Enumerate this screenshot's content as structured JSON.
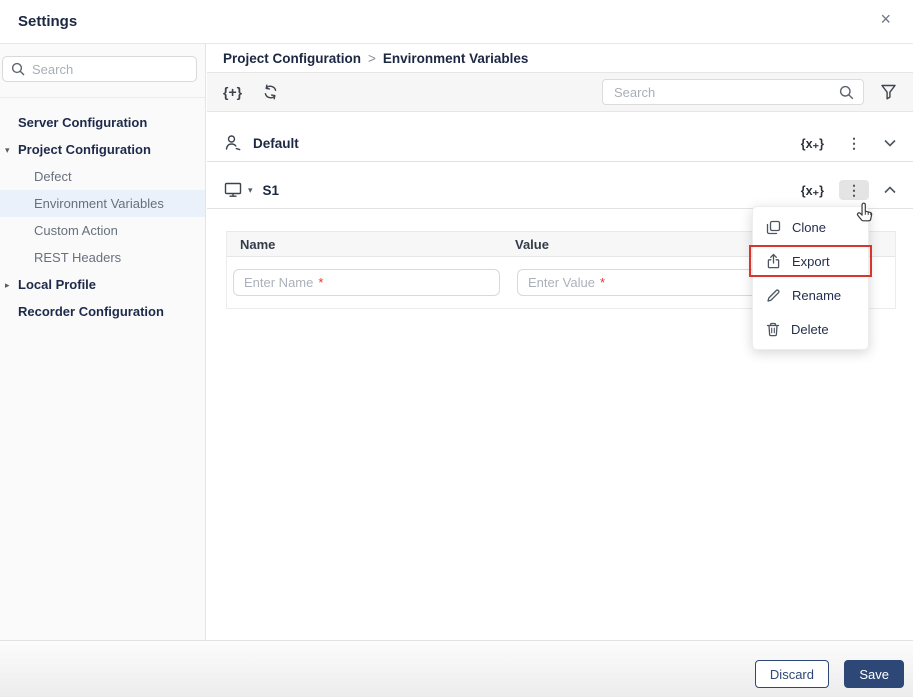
{
  "window": {
    "title": "Settings",
    "close_icon": "×"
  },
  "sidebar": {
    "search": {
      "placeholder": "Search"
    },
    "items": [
      {
        "label": "Server Configuration"
      },
      {
        "label": "Project Configuration",
        "arrow": "▾"
      },
      {
        "label": "Defect"
      },
      {
        "label": "Environment Variables"
      },
      {
        "label": "Custom Action"
      },
      {
        "label": "REST Headers"
      },
      {
        "label": "Local Profile",
        "arrow": "▸"
      },
      {
        "label": "Recorder Configuration"
      }
    ],
    "selected_item": "Environment Variables"
  },
  "breadcrumb": {
    "items": [
      "Project Configuration",
      "Environment Variables"
    ],
    "separator": ">"
  },
  "toolbar": {
    "add_variable_set_icon": "{+}",
    "search": {
      "placeholder": "Search"
    }
  },
  "sections": [
    {
      "label": "Default",
      "variables_icon": "{x₊}",
      "kebab_icon": "⋮",
      "state": "collapsed"
    },
    {
      "label": "S1",
      "variables_icon": "{x₊}",
      "kebab_icon": "⋮",
      "caret_icon": "▾",
      "state": "expanded"
    }
  ],
  "table": {
    "columns": [
      "Name",
      "Value"
    ],
    "new_row": {
      "name_placeholder": "Enter Name",
      "value_placeholder": "Enter Value",
      "required_marker": "*"
    }
  },
  "context_menu": {
    "items": [
      {
        "label": "Clone"
      },
      {
        "label": "Export",
        "highlighted": true
      },
      {
        "label": "Rename"
      },
      {
        "label": "Delete"
      }
    ]
  },
  "footer": {
    "discard_label": "Discard",
    "save_label": "Save"
  },
  "colors": {
    "accent_navy": "#2d4876",
    "highlight_red": "#d8352e",
    "selected_item_bg": "#eaf1fb"
  }
}
